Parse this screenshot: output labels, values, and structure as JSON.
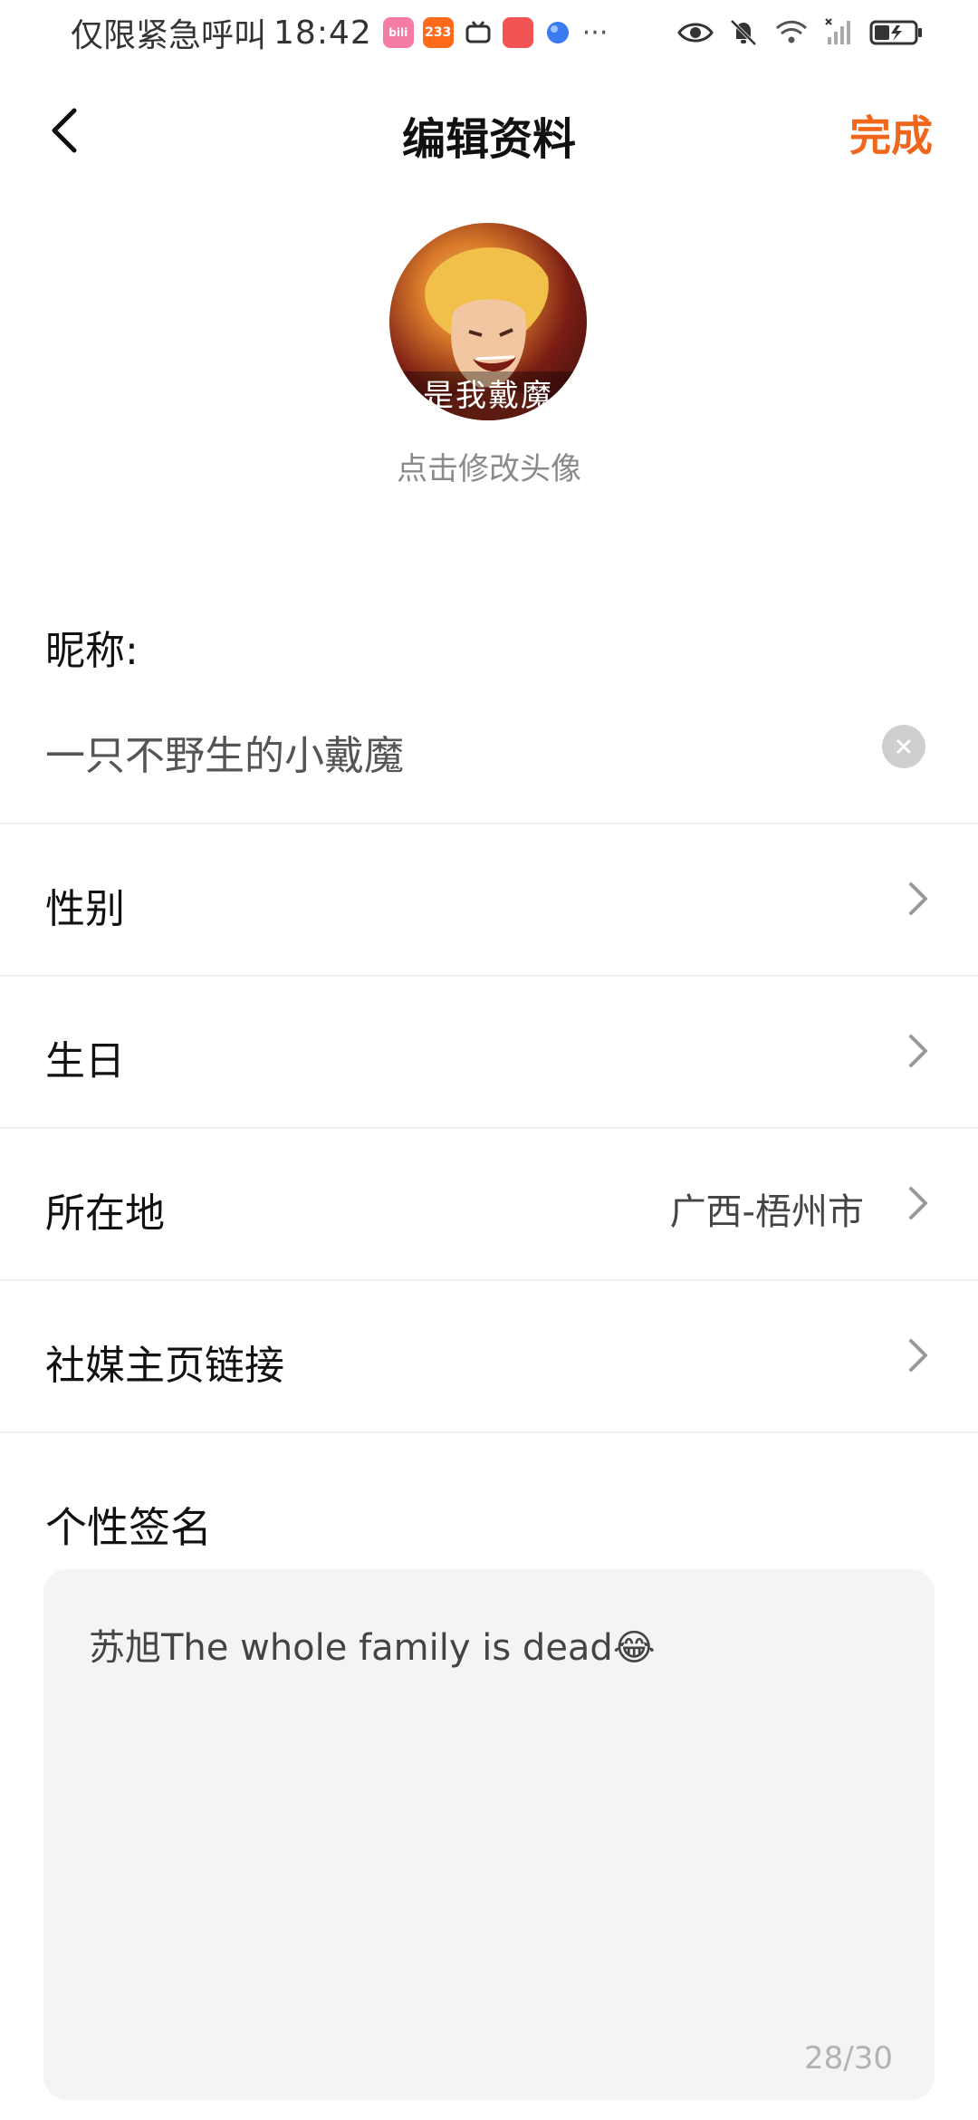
{
  "status_bar": {
    "carrier_text": "仅限紧急呼叫",
    "time": "18:42",
    "apps": [
      {
        "name": "bilibili-icon",
        "label": "bili",
        "color": "#f57ca7"
      },
      {
        "name": "233-icon",
        "label": "233",
        "color": "#ff6a1a"
      },
      {
        "name": "tv-icon",
        "label": "",
        "color": "#ffffff"
      },
      {
        "name": "huawei-icon",
        "label": "",
        "color": "#f25454"
      },
      {
        "name": "browser-icon",
        "label": "",
        "color": "#3a7bf0"
      }
    ],
    "more": "···"
  },
  "nav": {
    "title": "编辑资料",
    "done_label": "完成",
    "accent_color": "#f2661c"
  },
  "avatar": {
    "overlay_text": "是我戴魔",
    "hint": "点击修改头像"
  },
  "nickname": {
    "label": "昵称:",
    "value": "一只不野生的小戴魔"
  },
  "rows": [
    {
      "label": "性别",
      "value": ""
    },
    {
      "label": "生日",
      "value": ""
    },
    {
      "label": "所在地",
      "value": "广西-梧州市"
    },
    {
      "label": "社媒主页链接",
      "value": ""
    }
  ],
  "signature": {
    "label": "个性签名",
    "text": "苏旭The whole family is dead😂",
    "counter": "28/30"
  }
}
